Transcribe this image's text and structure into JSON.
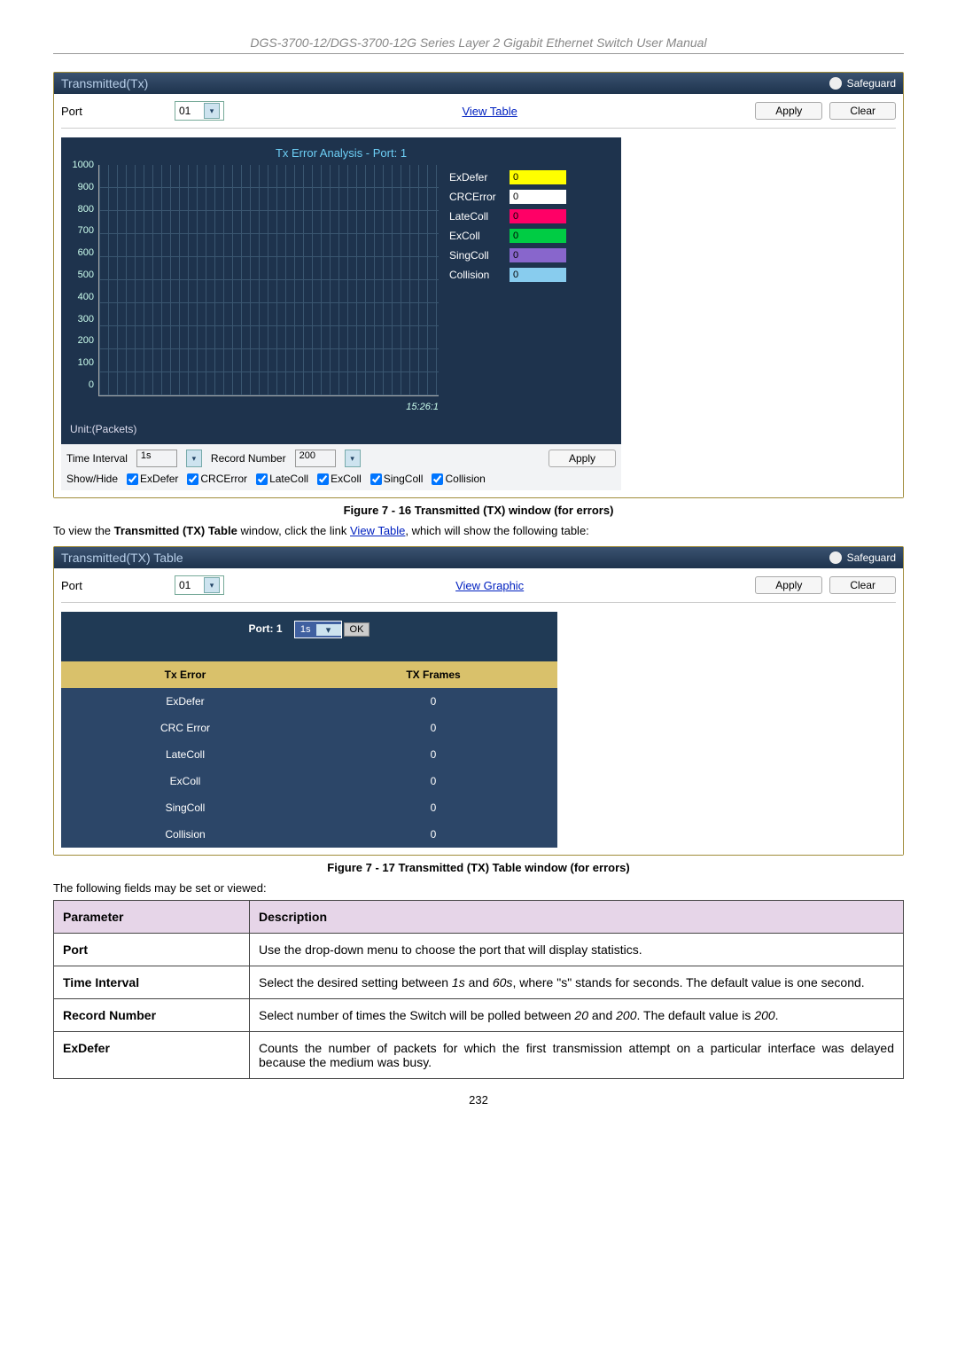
{
  "header": {
    "title": "DGS-3700-12/DGS-3700-12G Series Layer 2 Gigabit Ethernet Switch User Manual"
  },
  "panel1": {
    "title": "Transmitted(Tx)",
    "safeguard": "Safeguard",
    "port_label": "Port",
    "port_value": "01",
    "view_link": "View Table",
    "apply": "Apply",
    "clear": "Clear",
    "chart_title": "Tx Error Analysis - Port: 1",
    "time": "15:26:1",
    "unit": "Unit:(Packets)",
    "controls": {
      "time_interval_label": "Time Interval",
      "time_interval_value": "1s",
      "record_label": "Record Number",
      "record_value": "200",
      "apply": "Apply",
      "showhide": "Show/Hide"
    }
  },
  "caption1": "Figure 7 - 16 Transmitted (TX) window (for errors)",
  "intertext": {
    "pre": "To view the ",
    "bold": "Transmitted (TX) Table",
    "mid": " window, click the link ",
    "link": "View Table",
    "post": ", which will show the following table:"
  },
  "panel2": {
    "title": "Transmitted(TX) Table",
    "safeguard": "Safeguard",
    "port_label": "Port",
    "port_value": "01",
    "view_link": "View Graphic",
    "apply": "Apply",
    "clear": "Clear",
    "port_header": "Port: 1",
    "interval": "1s",
    "ok": "OK",
    "head_error": "Tx Error",
    "head_frames": "TX Frames",
    "rows": [
      {
        "label": "ExDefer",
        "value": "0"
      },
      {
        "label": "CRC Error",
        "value": "0"
      },
      {
        "label": "LateColl",
        "value": "0"
      },
      {
        "label": "ExColl",
        "value": "0"
      },
      {
        "label": "SingColl",
        "value": "0"
      },
      {
        "label": "Collision",
        "value": "0"
      }
    ]
  },
  "caption2": "Figure 7 - 17 Transmitted (TX) Table window (for errors)",
  "fields_text": "The following fields may be set or viewed:",
  "param_table": {
    "h1": "Parameter",
    "h2": "Description",
    "rows": [
      {
        "p": "Port",
        "d": "Use the drop-down menu to choose the port that will display statistics."
      },
      {
        "p": "Time Interval",
        "d": "Select the desired setting between 1s and 60s, where \"s\" stands for seconds. The default value is one second.",
        "i1": "1s",
        "i2": "60s"
      },
      {
        "p": "Record Number",
        "d": "Select number of times the Switch will be polled between 20 and 200. The default value is 200.",
        "i1": "20",
        "i2": "200",
        "i3": "200"
      },
      {
        "p": "ExDefer",
        "d": "Counts the number of packets for which the first transmission attempt on a particular interface was delayed because the medium was busy."
      }
    ]
  },
  "pagenum": "232",
  "chart_data": {
    "type": "line",
    "title": "Tx Error Analysis - Port: 1",
    "ylabel": "Packets",
    "ylim": [
      0,
      1000
    ],
    "yticks": [
      0,
      100,
      200,
      300,
      400,
      500,
      600,
      700,
      800,
      900,
      1000
    ],
    "x_time": "15:26:1",
    "series": [
      {
        "name": "ExDefer",
        "color": "#ffff00",
        "value": 0
      },
      {
        "name": "CRCError",
        "color": "#ffffff",
        "value": 0
      },
      {
        "name": "LateColl",
        "color": "#ff0066",
        "value": 0
      },
      {
        "name": "ExColl",
        "color": "#00cc44",
        "value": 0
      },
      {
        "name": "SingColl",
        "color": "#8866cc",
        "value": 0
      },
      {
        "name": "Collision",
        "color": "#88ccee",
        "value": 0
      }
    ],
    "checkboxes": [
      "ExDefer",
      "CRCError",
      "LateColl",
      "ExColl",
      "SingColl",
      "Collision"
    ]
  }
}
